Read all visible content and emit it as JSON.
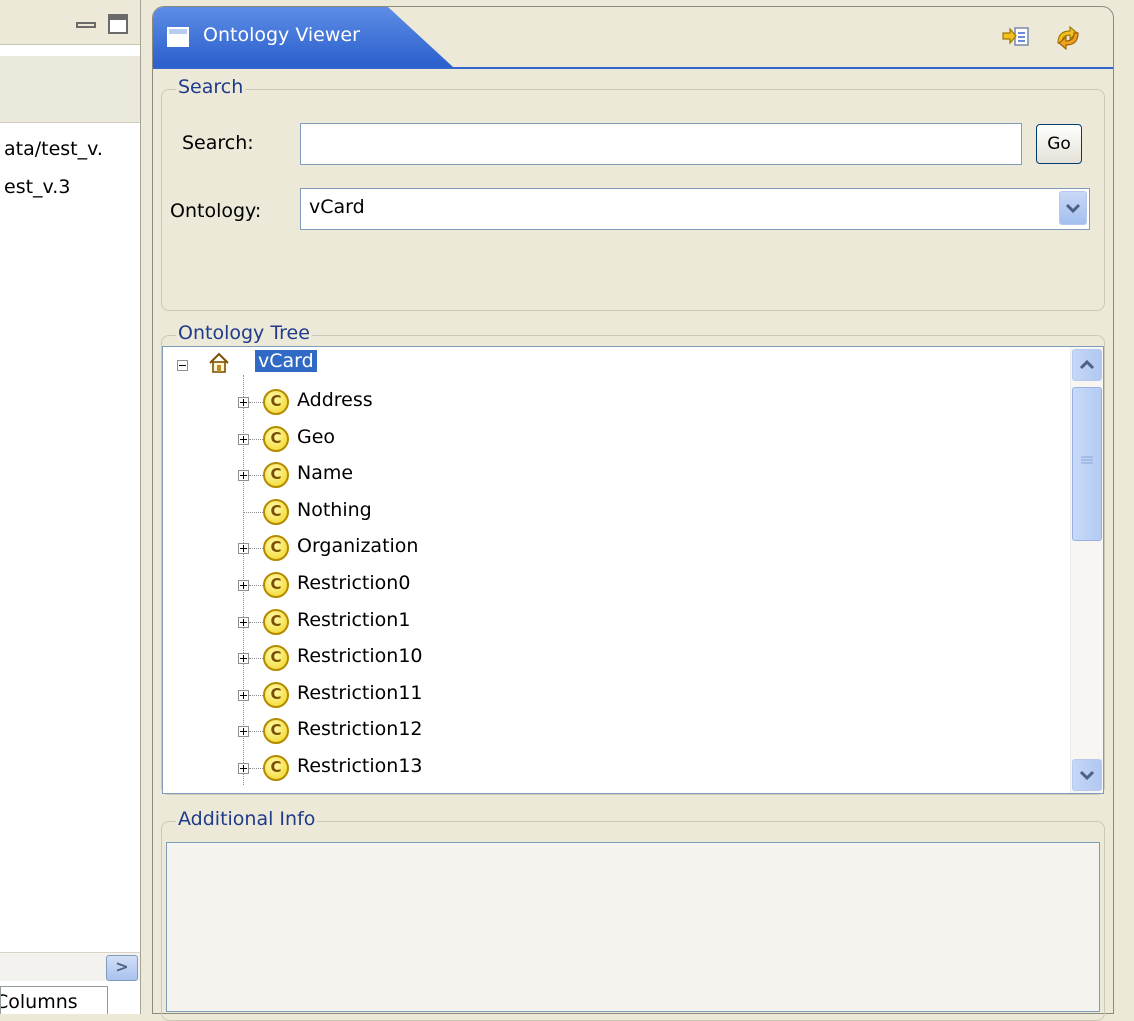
{
  "left_panel": {
    "lines": [
      "ata/test_v.",
      "est_v.3"
    ],
    "bottom_tab": "Columns"
  },
  "view": {
    "title": "Ontology Viewer",
    "toolbar": {
      "icons": [
        "link-with-editor-icon",
        "sync-icon"
      ]
    }
  },
  "search_group": {
    "legend": "Search",
    "search_label": "Search:",
    "search_value": "",
    "go_label": "Go",
    "ontology_label": "Ontology:",
    "ontology_selected": "vCard"
  },
  "tree_group": {
    "legend": "Ontology Tree",
    "root": "vCard",
    "nodes": [
      {
        "label": "Address",
        "expandable": true
      },
      {
        "label": "Geo",
        "expandable": true
      },
      {
        "label": "Name",
        "expandable": true
      },
      {
        "label": "Nothing",
        "expandable": false
      },
      {
        "label": "Organization",
        "expandable": true
      },
      {
        "label": "Restriction0",
        "expandable": true
      },
      {
        "label": "Restriction1",
        "expandable": true
      },
      {
        "label": "Restriction10",
        "expandable": true
      },
      {
        "label": "Restriction11",
        "expandable": true
      },
      {
        "label": "Restriction12",
        "expandable": true
      },
      {
        "label": "Restriction13",
        "expandable": true
      }
    ],
    "class_icon_letter": "C"
  },
  "info_group": {
    "legend": "Additional Info",
    "content": ""
  }
}
